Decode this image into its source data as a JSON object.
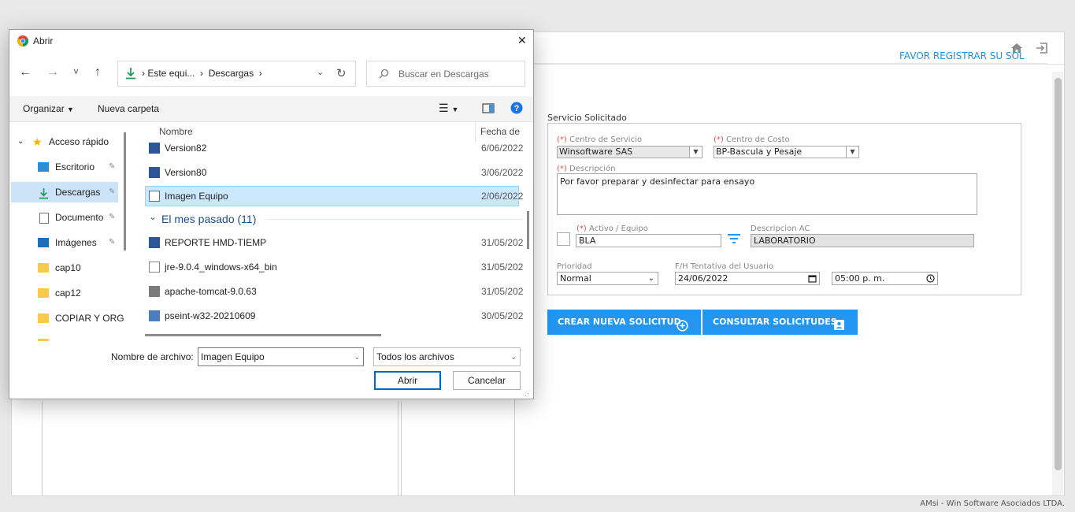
{
  "app": {
    "home_icon": "home-icon",
    "logout_icon": "logout-icon",
    "banner": "FAVOR REGISTRAR SU SOL",
    "footer": "AMsi - Win Software Asociados LTDA."
  },
  "form": {
    "section_title": "Servicio Solicitado",
    "required_mark": "(*)",
    "centro_servicio": {
      "label": "Centro de Servicio",
      "value": "Winsoftware SAS"
    },
    "centro_costo": {
      "label": "Centro de Costo",
      "value": "BP-Bascula y Pesaje"
    },
    "descripcion": {
      "label": "Descripción",
      "value": "Por favor preparar y desinfectar para ensayo"
    },
    "activo": {
      "label": "Activo / Equipo",
      "value": "BLA"
    },
    "descripcion_ac": {
      "label": "Descripcion AC",
      "value": "LABORATORIO"
    },
    "prioridad": {
      "label": "Prioridad",
      "value": "Normal"
    },
    "fecha": {
      "label": "F/H Tentativa del Usuario",
      "date": "24/06/2022",
      "time": "05:00 p. m."
    },
    "buttons": {
      "crear": "CREAR NUEVA SOLICITUD",
      "consultar": "CONSULTAR SOLICITUDES"
    }
  },
  "dialog": {
    "title": "Abrir",
    "close": "✕",
    "nav_arrows": {
      "back": "←",
      "forward": "→",
      "recent": "˅",
      "up": "↑"
    },
    "breadcrumb": [
      "Este equi...",
      "Descargas"
    ],
    "search_placeholder": "Buscar en Descargas",
    "toolbar": {
      "organizar": "Organizar",
      "nueva_carpeta": "Nueva carpeta"
    },
    "sidebar": [
      {
        "label": "Acceso rápido"
      },
      {
        "label": "Escritorio"
      },
      {
        "label": "Descargas"
      },
      {
        "label": "Documento"
      },
      {
        "label": "Imágenes"
      },
      {
        "label": "cap10"
      },
      {
        "label": "cap12"
      },
      {
        "label": "COPIAR Y ORG"
      }
    ],
    "columns": {
      "name": "Nombre",
      "date": "Fecha de"
    },
    "group_label": "El mes pasado (11)",
    "files_top": [
      {
        "name": "Version82",
        "date": "6/06/2022"
      },
      {
        "name": "Version80",
        "date": "3/06/2022"
      },
      {
        "name": "Imagen Equipo",
        "date": "2/06/2022"
      }
    ],
    "files_month": [
      {
        "name": "REPORTE HMD-TIEMP",
        "date": "31/05/202"
      },
      {
        "name": "jre-9.0.4_windows-x64_bin",
        "date": "31/05/202"
      },
      {
        "name": "apache-tomcat-9.0.63",
        "date": "31/05/202"
      },
      {
        "name": "pseint-w32-20210609",
        "date": "30/05/202"
      }
    ],
    "filename_label": "Nombre de archivo:",
    "filename_value": "Imagen Equipo",
    "filetype_value": "Todos los archivos",
    "open_button": "Abrir",
    "cancel_button": "Cancelar"
  }
}
